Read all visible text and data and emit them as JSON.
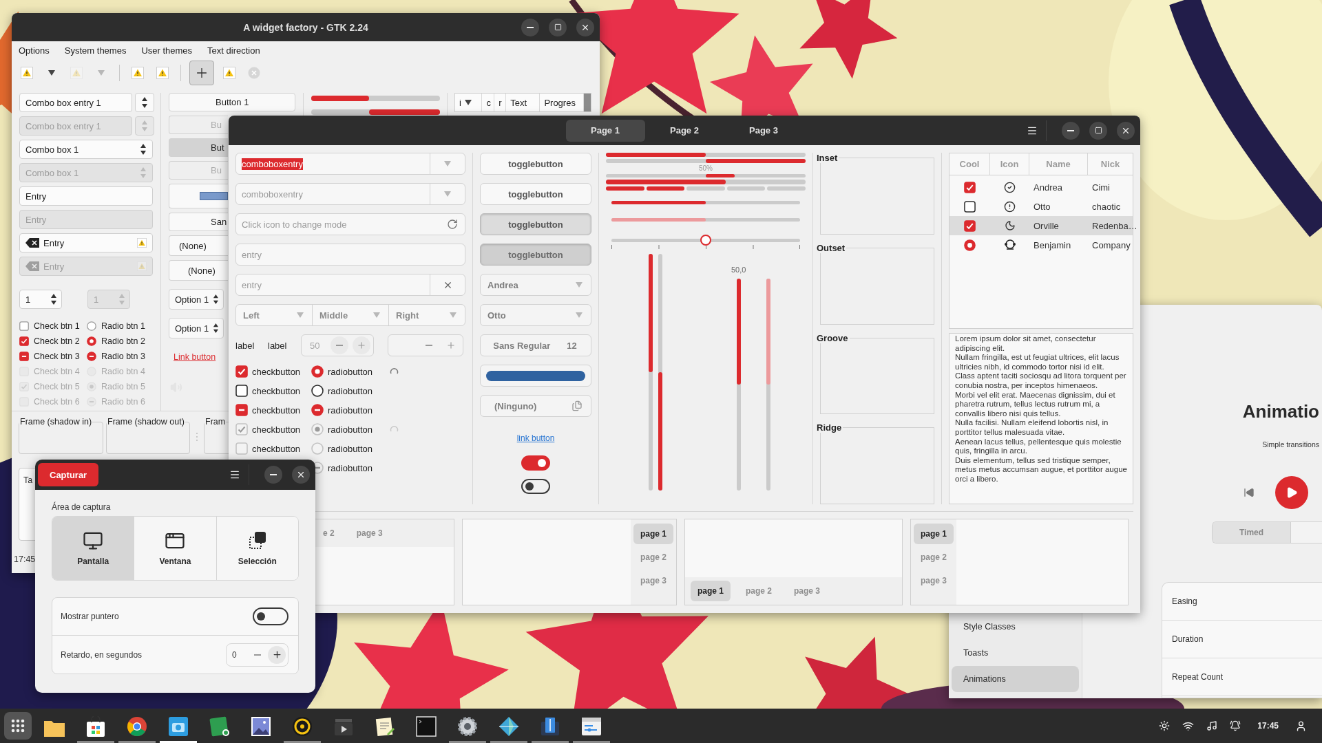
{
  "gtk2": {
    "title": "A widget factory - GTK 2.24",
    "menu": [
      "Options",
      "System themes",
      "User themes",
      "Text direction"
    ],
    "toolbar": [
      {
        "kind": "warning",
        "disabled": false,
        "pressed": false
      },
      {
        "kind": "arrow",
        "disabled": false,
        "pressed": false
      },
      {
        "kind": "warning",
        "disabled": true,
        "pressed": false
      },
      {
        "kind": "arrow",
        "disabled": true,
        "pressed": false
      },
      {
        "kind": "separator"
      },
      {
        "kind": "warning",
        "disabled": false,
        "pressed": false
      },
      {
        "kind": "warning",
        "disabled": false,
        "pressed": false
      },
      {
        "kind": "separator"
      },
      {
        "kind": "add",
        "disabled": false,
        "pressed": true
      },
      {
        "kind": "warning",
        "disabled": false,
        "pressed": false
      },
      {
        "kind": "stop",
        "disabled": true,
        "pressed": false
      }
    ],
    "fields": [
      {
        "kind": "combo_entry",
        "text": "Combo box entry 1",
        "disabled": false
      },
      {
        "kind": "combo_entry",
        "text": "Combo box entry 1",
        "disabled": true
      },
      {
        "kind": "combo",
        "text": "Combo box 1",
        "disabled": false
      },
      {
        "kind": "combo",
        "text": "Combo box 1",
        "disabled": true
      },
      {
        "kind": "entry",
        "text": "Entry",
        "disabled": false
      },
      {
        "kind": "entry",
        "text": "Entry",
        "disabled": true
      },
      {
        "kind": "icon_entry",
        "text": "Entry",
        "disabled": false
      },
      {
        "kind": "icon_entry",
        "text": "Entry",
        "disabled": true
      }
    ],
    "spins": [
      {
        "value": "1",
        "disabled": false
      },
      {
        "value": "1",
        "disabled": true
      }
    ],
    "checks": [
      {
        "label": "Check btn 1",
        "checked": false,
        "mixed": false,
        "disabled": false
      },
      {
        "label": "Check btn 2",
        "checked": true,
        "mixed": false,
        "disabled": false
      },
      {
        "label": "Check btn 3",
        "mixed": true,
        "disabled": false
      },
      {
        "label": "Check btn 4",
        "checked": false,
        "mixed": false,
        "disabled": true
      },
      {
        "label": "Check btn 5",
        "checked": true,
        "mixed": false,
        "disabled": true
      },
      {
        "label": "Check btn 6",
        "checked": false,
        "mixed": false,
        "disabled": true
      }
    ],
    "radios": [
      {
        "label": "Radio btn 1",
        "checked": false,
        "mixed": false,
        "disabled": false
      },
      {
        "label": "Radio btn 2",
        "checked": true,
        "mixed": false,
        "disabled": false
      },
      {
        "label": "Radio btn 3",
        "mixed": true,
        "disabled": false
      },
      {
        "label": "Radio btn 4",
        "checked": false,
        "mixed": false,
        "disabled": true
      },
      {
        "label": "Radio btn 5",
        "checked": true,
        "mixed": false,
        "disabled": true
      },
      {
        "label": "Radio btn 6",
        "mixed": true,
        "disabled": true
      }
    ],
    "middle": [
      {
        "kind": "button",
        "text": "Button 1",
        "disabled": false,
        "pressed": false
      },
      {
        "kind": "button",
        "text": "Bu",
        "disabled": true,
        "pressed": false
      },
      {
        "kind": "button",
        "text": "But",
        "disabled": false,
        "pressed": true
      },
      {
        "kind": "button",
        "text": "Bu",
        "disabled": true,
        "pressed": false
      },
      {
        "kind": "color"
      },
      {
        "kind": "button",
        "text": "San",
        "disabled": false,
        "pressed": false
      },
      {
        "kind": "combo",
        "text": "(None)"
      },
      {
        "kind": "combo_entry",
        "text": "(None)"
      },
      {
        "kind": "option",
        "text": "Option 1"
      },
      {
        "kind": "option",
        "text": "Option 1"
      },
      {
        "kind": "link",
        "text": "Link button"
      },
      {
        "kind": "volume"
      }
    ],
    "progress": [
      {
        "level": 0.45,
        "inverted": false
      },
      {
        "level": 0.55,
        "inverted": true
      }
    ],
    "tree_columns": [
      "i",
      "c",
      "r",
      "Text",
      "Progres"
    ],
    "frames": [
      "Frame (shadow in)",
      "Frame (shadow out)",
      "Fram"
    ],
    "text_view": "Ta",
    "status": "17:45"
  },
  "gtk3": {
    "tabs": [
      {
        "label": "Page 1",
        "selected": true
      },
      {
        "label": "Page 2",
        "selected": false
      },
      {
        "label": "Page 3",
        "selected": false
      }
    ],
    "combo_entries": [
      {
        "text": "comboboxentry",
        "highlighted": true,
        "disabled": false
      },
      {
        "text": "comboboxentry",
        "highlighted": false,
        "disabled": true
      }
    ],
    "entries": [
      {
        "kind": "mode",
        "placeholder": "Click icon to change mode"
      },
      {
        "kind": "plain",
        "placeholder": "entry"
      },
      {
        "kind": "clear",
        "placeholder": "entry"
      }
    ],
    "combos": [
      "Left",
      "Middle",
      "Right"
    ],
    "labels": [
      "label",
      "label"
    ],
    "spin": {
      "value": "50",
      "disabled": true
    },
    "checks": [
      {
        "label": "checkbutton",
        "checked": true,
        "mixed": false,
        "disabled": false
      },
      {
        "label": "checkbutton",
        "checked": false,
        "mixed": false,
        "disabled": false
      },
      {
        "label": "checkbutton",
        "mixed": true,
        "disabled": false
      },
      {
        "label": "checkbutton",
        "checked": true,
        "mixed": false,
        "disabled": true
      },
      {
        "label": "checkbutton",
        "checked": false,
        "mixed": false,
        "disabled": true
      }
    ],
    "radios": [
      {
        "label": "radiobutton",
        "checked": true,
        "mixed": false,
        "disabled": false,
        "spinner": true
      },
      {
        "label": "radiobutton",
        "checked": false,
        "mixed": false,
        "disabled": false,
        "spinner": false
      },
      {
        "label": "radiobutton",
        "mixed": true,
        "disabled": false,
        "spinner": false
      },
      {
        "label": "radiobutton",
        "checked": true,
        "mixed": false,
        "disabled": true,
        "spinner": true
      },
      {
        "label": "radiobutton",
        "checked": false,
        "mixed": false,
        "disabled": true,
        "spinner": false
      },
      {
        "label": "radiobutton",
        "mixed": true,
        "disabled": true,
        "spinner": false
      }
    ],
    "toggles": [
      {
        "label": "togglebutton",
        "pressed": false,
        "disabled": false
      },
      {
        "label": "togglebutton",
        "pressed": false,
        "disabled": false
      },
      {
        "label": "togglebutton",
        "pressed": true,
        "disabled": false
      },
      {
        "label": "togglebutton",
        "pressed": true,
        "disabled": true
      }
    ],
    "people": [
      "Andrea",
      "Otto"
    ],
    "font": {
      "name": "Sans Regular",
      "size": "12"
    },
    "file": "(Ninguno)",
    "link": "link button",
    "switches": [
      {
        "on": true
      },
      {
        "on": false
      }
    ],
    "bars": [
      {
        "level": 0.5,
        "inverted": false
      },
      {
        "level": 0.5,
        "inverted": true
      }
    ],
    "bar_text": "50%",
    "bar_thick": {
      "level": 0.6
    },
    "bar_segmented": {
      "level": 0.4
    },
    "scales": [
      {
        "level": 0.5,
        "disabled": false
      },
      {
        "level": 0.5,
        "disabled": true
      }
    ],
    "knob_scale": {
      "level": 0.5
    },
    "vbars": [
      {
        "level": 0.5,
        "inverted": false
      },
      {
        "level": 0.5,
        "inverted": true
      }
    ],
    "vscale_value": "50,0",
    "vscales": [
      {
        "level": 0.5,
        "disabled": false
      },
      {
        "level": 0.5,
        "disabled": true
      }
    ],
    "frames": [
      "Inset",
      "Outset",
      "Groove",
      "Ridge"
    ],
    "tree": {
      "columns": [
        "Cool",
        "Icon",
        "Name",
        "Nick"
      ],
      "rows": [
        {
          "kind": "check",
          "checked": true,
          "name": "Andrea",
          "nick": "Cimi",
          "selected": false
        },
        {
          "kind": "check",
          "checked": false,
          "name": "Otto",
          "nick": "chaotic",
          "selected": false
        },
        {
          "kind": "check",
          "checked": true,
          "name": "Orville",
          "nick": "Redenba…",
          "selected": true
        },
        {
          "kind": "radio",
          "checked": true,
          "name": "Benjamin",
          "nick": "Company",
          "selected": false
        }
      ]
    },
    "text_view": [
      "Lorem ipsum dolor sit amet, consectetur adipiscing elit.",
      "Nullam fringilla, est ut feugiat ultrices, elit lacus ultricies nibh, id commodo tortor nisi id elit.",
      "Class aptent taciti sociosqu ad litora torquent per conubia nostra, per inceptos himenaeos.",
      "Morbi vel elit erat. Maecenas dignissim, dui et pharetra rutrum, tellus lectus rutrum mi, a convallis libero nisi quis tellus.",
      "Nulla facilisi. Nullam eleifend lobortis nisl, in porttitor tellus malesuada vitae.",
      "Aenean lacus tellus, pellentesque quis molestie quis, fringilla in arcu.",
      "Duis elementum, tellus sed tristique semper, metus metus accumsan augue, et porttitor augue orci a libero."
    ],
    "notebooks": [
      {
        "kind": "top",
        "tabs": [
          {
            "label": "e 2",
            "selected": false
          },
          {
            "label": "page 3",
            "selected": false
          }
        ]
      },
      {
        "kind": "right",
        "tabs": [
          {
            "label": "page 1",
            "selected": true
          },
          {
            "label": "page 2",
            "selected": false
          },
          {
            "label": "page 3",
            "selected": false
          }
        ]
      },
      {
        "kind": "bottom",
        "tabs": [
          {
            "label": "page 1",
            "selected": true
          },
          {
            "label": "page 2",
            "selected": false
          },
          {
            "label": "page 3",
            "selected": false
          }
        ]
      },
      {
        "kind": "left",
        "tabs": [
          {
            "label": "page 1",
            "selected": true
          },
          {
            "label": "page 2",
            "selected": false
          },
          {
            "label": "page 3",
            "selected": false
          }
        ]
      }
    ]
  },
  "demo": {
    "sidebar": [
      {
        "label": "Style Classes",
        "selected": false
      },
      {
        "label": "Toasts",
        "selected": false
      },
      {
        "label": "Animations",
        "selected": true
      }
    ],
    "title": "Animatio",
    "subtitle": "Simple transitions",
    "modes": [
      {
        "label": "Timed",
        "selected": true
      }
    ],
    "rows": [
      "Easing",
      "Duration",
      "Repeat Count"
    ]
  },
  "capture": {
    "button": "Capturar",
    "area_label": "Área de captura",
    "modes": [
      {
        "label": "Pantalla",
        "selected": true
      },
      {
        "label": "Ventana",
        "selected": false
      },
      {
        "label": "Selección",
        "selected": false
      }
    ],
    "pointer": {
      "label": "Mostrar puntero",
      "on": false
    },
    "delay": {
      "label": "Retardo, en segundos",
      "value": "0"
    }
  },
  "taskbar": {
    "apps": [
      {
        "running": false
      },
      {
        "running": true,
        "focused": false
      },
      {
        "running": true,
        "focused": false
      },
      {
        "running": true,
        "focused": true
      },
      {
        "running": false
      },
      {
        "running": false
      },
      {
        "running": true,
        "focused": false
      },
      {
        "running": false
      },
      {
        "running": false
      },
      {
        "running": false
      },
      {
        "running": true,
        "focused": false
      },
      {
        "running": true,
        "focused": false
      },
      {
        "running": true,
        "focused": false
      },
      {
        "running": true,
        "focused": false
      }
    ],
    "clock": "17:45"
  }
}
